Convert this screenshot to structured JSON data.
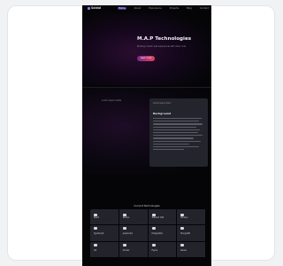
{
  "nav": {
    "logo": "Saidul",
    "links": [
      "Home",
      "About",
      "Experience",
      "Projects",
      "Blog",
      "Contact"
    ]
  },
  "hero": {
    "title": "M.A.P Technologies",
    "subtitle": "Building modern web experiences with clean code",
    "button": "Learn more"
  },
  "about": {
    "left_label": "Lorem ipsum stats",
    "card_top": "Lorem ipsum dolor",
    "card_title": "Background"
  },
  "tech": {
    "title": "Current Technologies",
    "items": [
      "React",
      "Next.js",
      "Tailwind CSS",
      "Node.js",
      "TypeScript",
      "JavaScript",
      "PostgreSQL",
      "MongoDB",
      "Git",
      "Docker",
      "Figma",
      "Redux"
    ]
  },
  "colors": {
    "page_bg": "#f1f2f4",
    "device_bg": "#050507",
    "accent_gradient_start": "#7a2a8a",
    "accent_gradient_end": "#e3455a",
    "card_bg": "#24242c"
  }
}
